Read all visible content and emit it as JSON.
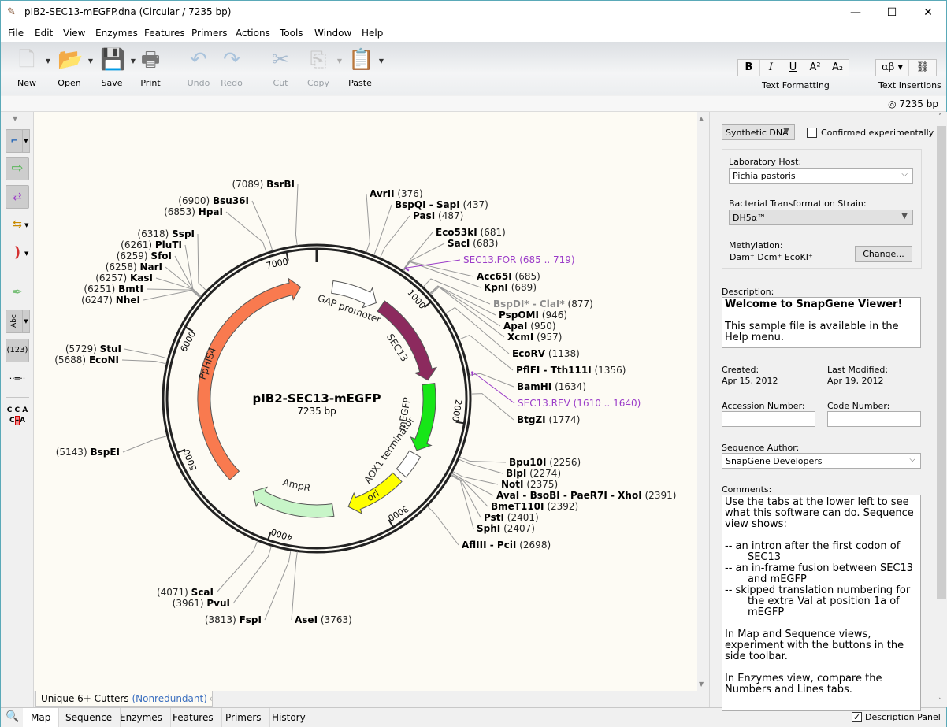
{
  "window": {
    "title": "pIB2-SEC13-mEGFP.dna  (Circular / 7235 bp)",
    "controls": {
      "minimize": "—",
      "maximize": "☐",
      "close": "✕"
    }
  },
  "menu": [
    "File",
    "Edit",
    "View",
    "Enzymes",
    "Features",
    "Primers",
    "Actions",
    "Tools",
    "Window",
    "Help"
  ],
  "toolbar": {
    "new": "New",
    "open": "Open",
    "save": "Save",
    "print": "Print",
    "undo": "Undo",
    "redo": "Redo",
    "cut": "Cut",
    "copy": "Copy",
    "paste": "Paste",
    "text_formatting_label": "Text Formatting",
    "text_insertions_label": "Text Insertions",
    "fmt_bold": "B",
    "fmt_italic": "I",
    "fmt_underline": "U",
    "fmt_superscript": "A²",
    "fmt_subscript": "A₂",
    "ins_greek": "αβ ▾",
    "ins_link": "⛓"
  },
  "status": {
    "length": "7235 bp"
  },
  "sidebar": {
    "icons": [
      "restriction-site-icon",
      "feature-arrow-icon",
      "strands-icon",
      "primers-icon",
      "orf-icon",
      "pen-icon",
      "text-label-icon",
      "numbers-icon",
      "line-icon",
      "translation-icon"
    ],
    "abc_label": "Abc",
    "numbers_label": "(123)",
    "cca_label": "C C A"
  },
  "map": {
    "name": "pIB2-SEC13-mEGFP",
    "length_bp": 7235,
    "length_label": "7235 bp",
    "ticks": [
      {
        "pos": 1000,
        "label": "1000"
      },
      {
        "pos": 2000,
        "label": "2000"
      },
      {
        "pos": 3000,
        "label": "3000"
      },
      {
        "pos": 4000,
        "label": "4000"
      },
      {
        "pos": 5000,
        "label": "5000"
      },
      {
        "pos": 6000,
        "label": "6000"
      },
      {
        "pos": 7000,
        "label": "7000"
      }
    ],
    "features": [
      {
        "name": "GAP promoter",
        "start": 160,
        "end": 640,
        "dir": 1,
        "color": "#ffffff"
      },
      {
        "name": "SEC13",
        "start": 700,
        "end": 1620,
        "dir": 1,
        "color": "#8c2a5e"
      },
      {
        "name": "mEGFP",
        "start": 1660,
        "end": 2360,
        "dir": 1,
        "color": "#17e617"
      },
      {
        "name": "AOX1 terminator",
        "start": 2400,
        "end": 2640,
        "dir": 0,
        "color": "#ffffff"
      },
      {
        "name": "ori",
        "start": 2700,
        "end": 3290,
        "dir": 1,
        "color": "#ffff00"
      },
      {
        "name": "AmpR",
        "start": 3450,
        "end": 4310,
        "dir": 1,
        "color": "#c8f5c8"
      },
      {
        "name": "PpHIS4",
        "start": 4560,
        "end": 7070,
        "dir": 1,
        "color": "#f97a4f"
      }
    ],
    "enzymes_right": [
      {
        "name": "AvrII",
        "pos": "(376)"
      },
      {
        "name": "BspQI - SapI",
        "pos": "(437)"
      },
      {
        "name": "PasI",
        "pos": "(487)"
      },
      {
        "name": "Eco53kI",
        "pos": "(681)"
      },
      {
        "name": "SacI",
        "pos": "(683)"
      },
      {
        "name": "Acc65I",
        "pos": "(685)"
      },
      {
        "name": "KpnI",
        "pos": "(689)"
      },
      {
        "name": "BspDI* - ClaI*",
        "pos": "(877)",
        "gray": true
      },
      {
        "name": "PspOMI",
        "pos": "(946)"
      },
      {
        "name": "ApaI",
        "pos": "(950)"
      },
      {
        "name": "XcmI",
        "pos": "(957)"
      },
      {
        "name": "EcoRV",
        "pos": "(1138)"
      },
      {
        "name": "PflFI - Tth111I",
        "pos": "(1356)"
      },
      {
        "name": "BamHI",
        "pos": "(1634)"
      },
      {
        "name": "BtgZI",
        "pos": "(1774)"
      },
      {
        "name": "Bpu10I",
        "pos": "(2256)"
      },
      {
        "name": "BlpI",
        "pos": "(2274)"
      },
      {
        "name": "NotI",
        "pos": "(2375)"
      },
      {
        "name": "AvaI - BsoBI - PaeR7I - XhoI",
        "pos": "(2391)"
      },
      {
        "name": "BmeT110I",
        "pos": "(2392)"
      },
      {
        "name": "PstI",
        "pos": "(2401)"
      },
      {
        "name": "SphI",
        "pos": "(2407)"
      },
      {
        "name": "AflIII - PciI",
        "pos": "(2698)"
      },
      {
        "name": "AseI",
        "pos": "(3763)"
      }
    ],
    "enzymes_left": [
      {
        "name": "BsrBI",
        "pos": "(7089)"
      },
      {
        "name": "Bsu36I",
        "pos": "(6900)"
      },
      {
        "name": "HpaI",
        "pos": "(6853)"
      },
      {
        "name": "SspI",
        "pos": "(6318)"
      },
      {
        "name": "PluTI",
        "pos": "(6261)"
      },
      {
        "name": "SfoI",
        "pos": "(6259)"
      },
      {
        "name": "NarI",
        "pos": "(6258)"
      },
      {
        "name": "KasI",
        "pos": "(6257)"
      },
      {
        "name": "BmtI",
        "pos": "(6251)"
      },
      {
        "name": "NheI",
        "pos": "(6247)"
      },
      {
        "name": "StuI",
        "pos": "(5729)"
      },
      {
        "name": "EcoNI",
        "pos": "(5688)"
      },
      {
        "name": "BspEI",
        "pos": "(5143)"
      },
      {
        "name": "ScaI",
        "pos": "(4071)"
      },
      {
        "name": "PvuI",
        "pos": "(3961)"
      },
      {
        "name": "FspI",
        "pos": "(3813)"
      }
    ],
    "primers": [
      {
        "name": "SEC13.FOR",
        "range": "(685 .. 719)"
      },
      {
        "name": "SEC13.REV",
        "range": "(1610 .. 1640)"
      }
    ]
  },
  "enzyme_set": {
    "label": "Unique 6+ Cutters",
    "qualifier": "(Nonredundant)"
  },
  "view_tabs": [
    "Map",
    "Sequence",
    "Enzymes",
    "Features",
    "Primers",
    "History"
  ],
  "active_view_tab": "Map",
  "panel": {
    "molecule_type": "Synthetic DNA",
    "confirmed_label": "Confirmed experimentally",
    "confirmed": false,
    "lab_host_label": "Laboratory Host:",
    "lab_host": "Pichia pastoris",
    "strain_label": "Bacterial Transformation Strain:",
    "strain": "DH5α™",
    "methylation_label": "Methylation:",
    "methylation": "Dam⁺  Dcm⁺  EcoKI⁺",
    "change_button": "Change...",
    "description_label": "Description:",
    "description_title": "Welcome to SnapGene Viewer!",
    "description_body": "This sample file is available in the Help menu.",
    "created_label": "Created:",
    "created": "Apr 15, 2012",
    "modified_label": "Last Modified:",
    "modified": "Apr 19, 2012",
    "accession_label": "Accession Number:",
    "accession": "",
    "code_label": "Code Number:",
    "code": "",
    "author_label": "Sequence Author:",
    "author": "SnapGene Developers",
    "comments_label": "Comments:",
    "comments": "Use the tabs at the lower left to see what this software can do. Sequence view shows:\n\n-- an intron after the first codon of\n       SEC13\n-- an in-frame fusion between SEC13\n       and mEGFP\n-- skipped translation numbering for\n       the extra Val at position 1a of\n       mEGFP\n\nIn Map and Sequence views, experiment with the buttons in the side toolbar.\n\nIn Enzymes view, compare the Numbers and Lines tabs.",
    "description_panel_label": "Description Panel",
    "description_panel_checked": true
  }
}
